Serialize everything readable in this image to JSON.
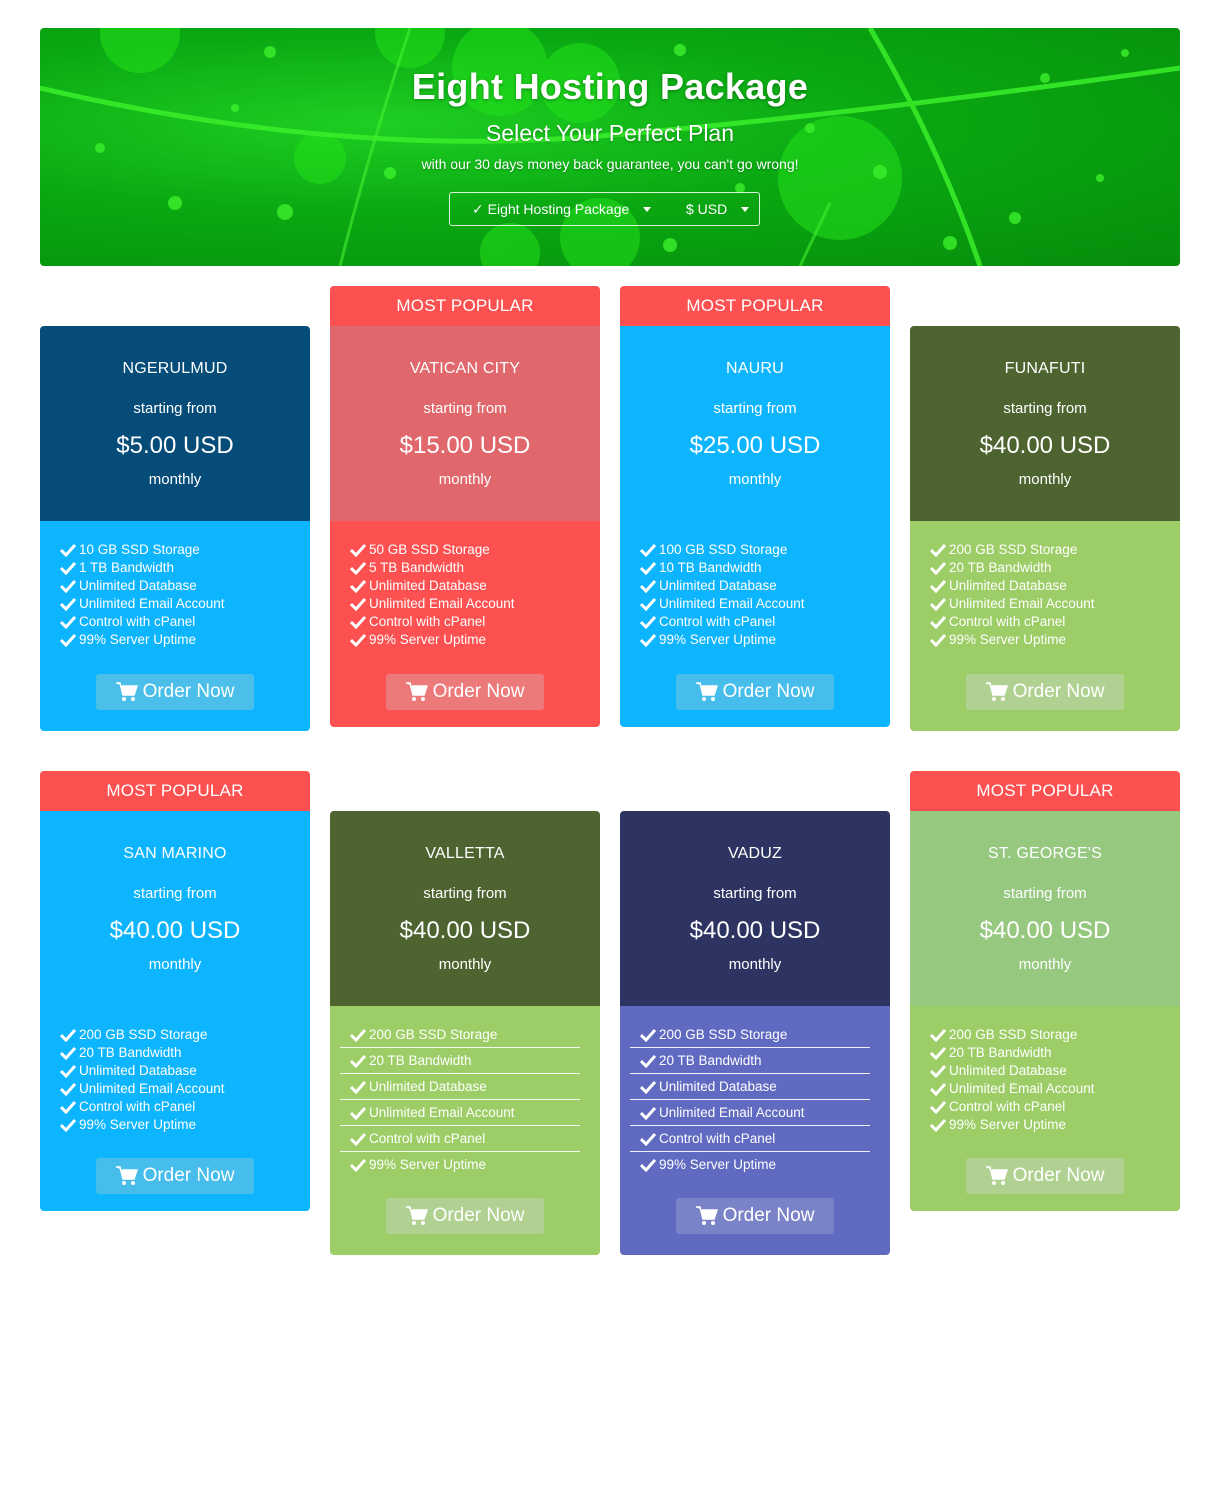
{
  "banner": {
    "title": "Eight Hosting Package",
    "subtitle": "Select Your Perfect Plan",
    "tagline": "with our 30 days money back guarantee, you can't go wrong!",
    "package_select": "✓ Eight Hosting Package",
    "currency_select": "$ USD"
  },
  "ribbon_label": "MOST POPULAR",
  "starting_label": "starting from",
  "period_label": "monthly",
  "order_label": "Order Now",
  "colors": {
    "ribbon": "#fd5050",
    "navy": "#064c79",
    "cyan": "#0db4fe",
    "coral": "#fd5050",
    "olive": "#4d6430",
    "light_green": "#9dcd66",
    "dark_blue": "#2e3461",
    "periwinkle": "#5f6ac0"
  },
  "plans": [
    {
      "name": "NGERULMUD",
      "price": "$5.00 USD",
      "features": [
        "10 GB SSD Storage",
        "1 TB Bandwidth",
        "Unlimited Database",
        "Unlimited Email Account",
        "Control with cPanel",
        "99% Server Uptime"
      ]
    },
    {
      "name": "VATICAN CITY",
      "price": "$15.00 USD",
      "features": [
        "50 GB SSD Storage",
        "5 TB Bandwidth",
        "Unlimited Database",
        "Unlimited Email Account",
        "Control with cPanel",
        "99% Server Uptime"
      ]
    },
    {
      "name": "NAURU",
      "price": "$25.00 USD",
      "features": [
        "100 GB SSD Storage",
        "10 TB Bandwidth",
        "Unlimited Database",
        "Unlimited Email Account",
        "Control with cPanel",
        "99% Server Uptime"
      ]
    },
    {
      "name": "FUNAFUTI",
      "price": "$40.00 USD",
      "features": [
        "200 GB SSD Storage",
        "20 TB Bandwidth",
        "Unlimited Database",
        "Unlimited Email Account",
        "Control with cPanel",
        "99% Server Uptime"
      ]
    },
    {
      "name": "SAN MARINO",
      "price": "$40.00 USD",
      "features": [
        "200 GB SSD Storage",
        "20 TB Bandwidth",
        "Unlimited Database",
        "Unlimited Email Account",
        "Control with cPanel",
        "99% Server Uptime"
      ]
    },
    {
      "name": "VALLETTA",
      "price": "$40.00 USD",
      "features": [
        "200 GB SSD Storage",
        "20 TB Bandwidth",
        "Unlimited Database",
        "Unlimited Email Account",
        "Control with cPanel",
        "99% Server Uptime"
      ]
    },
    {
      "name": "VADUZ",
      "price": "$40.00 USD",
      "features": [
        "200 GB SSD Storage",
        "20 TB Bandwidth",
        "Unlimited Database",
        "Unlimited Email Account",
        "Control with cPanel",
        "99% Server Uptime"
      ]
    },
    {
      "name": "ST. GEORGE'S",
      "price": "$40.00 USD",
      "features": [
        "200 GB SSD Storage",
        "20 TB Bandwidth",
        "Unlimited Database",
        "Unlimited Email Account",
        "Control with cPanel",
        "99% Server Uptime"
      ]
    }
  ]
}
